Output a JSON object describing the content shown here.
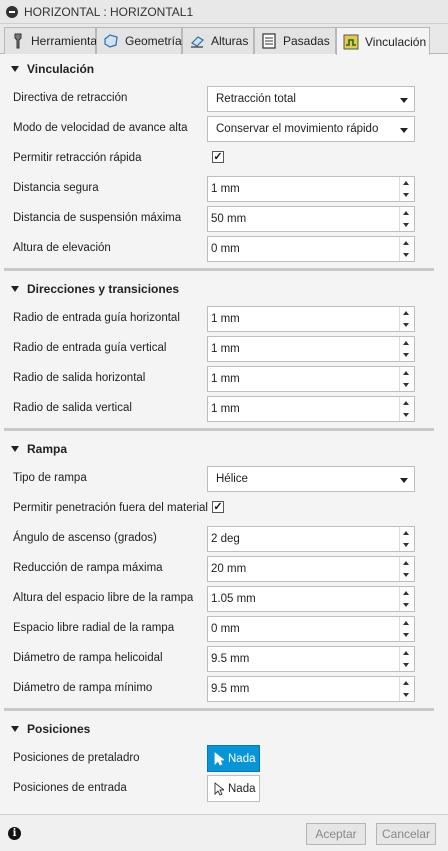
{
  "window": {
    "title": "HORIZONTAL : HORIZONTAL1"
  },
  "tabs": [
    {
      "label": "Herramienta",
      "icon": "tool-icon"
    },
    {
      "label": "Geometría",
      "icon": "geometry-icon"
    },
    {
      "label": "Alturas",
      "icon": "heights-icon"
    },
    {
      "label": "Pasadas",
      "icon": "passes-icon"
    },
    {
      "label": "Vinculación",
      "icon": "linking-icon",
      "active": true
    }
  ],
  "sections": {
    "vinculacion": {
      "title": "Vinculación",
      "directiva_label": "Directiva de retracción",
      "directiva_value": "Retracción total",
      "modo_label": "Modo de velocidad de avance alta",
      "modo_value": "Conservar el movimiento rápido",
      "permitir_label": "Permitir retracción rápida",
      "permitir_checked": true,
      "distancia_segura_label": "Distancia segura",
      "distancia_segura_value": "1 mm",
      "suspension_label": "Distancia de suspensión máxima",
      "suspension_value": "50 mm",
      "altura_label": "Altura de elevación",
      "altura_value": "0 mm"
    },
    "direcciones": {
      "title": "Direcciones y transiciones",
      "entrada_h_label": "Radio de entrada guía horizontal",
      "entrada_h_value": "1 mm",
      "entrada_v_label": "Radio de entrada guía vertical",
      "entrada_v_value": "1 mm",
      "salida_h_label": "Radio de salida horizontal",
      "salida_h_value": "1 mm",
      "salida_v_label": "Radio de salida vertical",
      "salida_v_value": "1 mm"
    },
    "rampa": {
      "title": "Rampa",
      "tipo_label": "Tipo de rampa",
      "tipo_value": "Hélice",
      "penetracion_label": "Permitir penetración fuera del material",
      "penetracion_checked": true,
      "angulo_label": "Ángulo de ascenso (grados)",
      "angulo_value": "2 deg",
      "reduccion_label": "Reducción de rampa máxima",
      "reduccion_value": "20 mm",
      "altura_libre_label": "Altura del espacio libre de la rampa",
      "altura_libre_value": "1.05 mm",
      "radial_label": "Espacio libre radial de la rampa",
      "radial_value": "0 mm",
      "helicoidal_label": "Diámetro de rampa helicoidal",
      "helicoidal_value": "9.5 mm",
      "minimo_label": "Diámetro de rampa mínimo",
      "minimo_value": "9.5 mm"
    },
    "posiciones": {
      "title": "Posiciones",
      "pretaladro_label": "Posiciones de pretaladro",
      "pretaladro_value": "Nada",
      "entrada_label": "Posiciones de entrada",
      "entrada_value": "Nada"
    }
  },
  "footer": {
    "accept_label": "Aceptar",
    "cancel_label": "Cancelar"
  },
  "colors": {
    "accent": "#0696d7",
    "panel": "#f4f4f4",
    "separator": "#c8c8c8"
  }
}
